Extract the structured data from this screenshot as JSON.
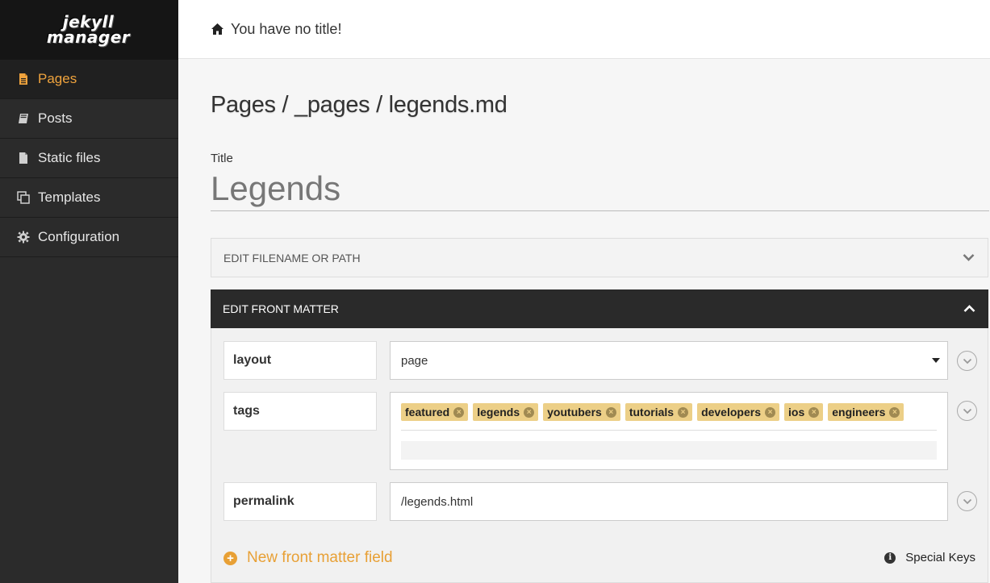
{
  "sidebar": {
    "logo_line1": "jekyll",
    "logo_line2": "manager",
    "items": [
      {
        "label": "Pages",
        "icon": "file-text-icon",
        "active": true
      },
      {
        "label": "Posts",
        "icon": "book-icon",
        "active": false
      },
      {
        "label": "Static files",
        "icon": "file-icon",
        "active": false
      },
      {
        "label": "Templates",
        "icon": "clone-icon",
        "active": false
      },
      {
        "label": "Configuration",
        "icon": "gear-icon",
        "active": false
      }
    ]
  },
  "header": {
    "icon": "home-icon",
    "site_title": "You have no title!"
  },
  "main": {
    "breadcrumb": "Pages / _pages / legends.md",
    "title_label": "Title",
    "title_value": "Legends",
    "filename_panel": "EDIT FILENAME OR PATH",
    "front_matter_panel": "EDIT FRONT MATTER",
    "front_matter": {
      "layout": {
        "key": "layout",
        "value": "page"
      },
      "tags": {
        "key": "tags",
        "values": [
          "featured",
          "legends",
          "youtubers",
          "tutorials",
          "developers",
          "ios",
          "engineers"
        ]
      },
      "permalink": {
        "key": "permalink",
        "value": "/legends.html"
      }
    },
    "new_field_label": "New front matter field",
    "special_keys_label": "Special Keys"
  },
  "colors": {
    "accent": "#efa33d",
    "sidebar_bg": "#2b2b2b",
    "tag_bg": "#eccf87",
    "panel_dark": "#2a2a2a"
  }
}
